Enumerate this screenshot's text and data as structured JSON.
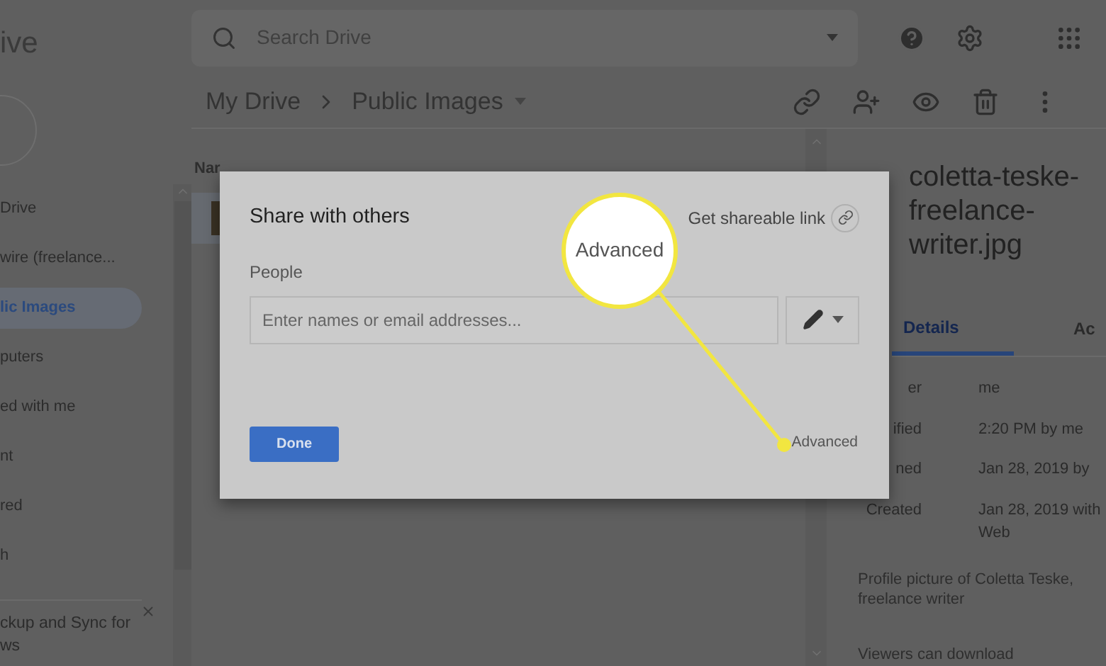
{
  "app_title": "ive",
  "sidebar": {
    "items": [
      {
        "label": "Drive",
        "selected": false
      },
      {
        "label": "wire (freelance...",
        "selected": false
      },
      {
        "label": "lic Images",
        "selected": true
      },
      {
        "label": "puters",
        "selected": false
      },
      {
        "label": "ed with me",
        "selected": false
      },
      {
        "label": "nt",
        "selected": false
      },
      {
        "label": "red",
        "selected": false
      },
      {
        "label": "h",
        "selected": false
      }
    ],
    "promo": {
      "text": "ckup and Sync for\nws"
    }
  },
  "search": {
    "placeholder": "Search Drive"
  },
  "breadcrumb": [
    "My Drive",
    "Public Images"
  ],
  "list": {
    "column_1": "Nar"
  },
  "details": {
    "title": "coletta-teske-freelance-writer.jpg",
    "tabs": [
      {
        "label": "Details",
        "selected": true
      },
      {
        "label": "Ac",
        "selected": false
      }
    ],
    "rows": [
      {
        "label": "er",
        "value": [
          "me"
        ]
      },
      {
        "label": "ified",
        "value": [
          "2:20 PM by me"
        ]
      },
      {
        "label": "ned",
        "value": [
          "Jan 28, 2019 by"
        ]
      },
      {
        "label": "Created",
        "value": [
          "Jan 28, 2019 with",
          "Web"
        ]
      }
    ],
    "description": "Profile picture of Coletta Teske, freelance writer",
    "download": "Viewers can download"
  },
  "dialog": {
    "title": "Share with others",
    "shareable_link": "Get shareable link",
    "people_label": "People",
    "input": {
      "placeholder": "Enter names or email addresses..."
    },
    "done": "Done",
    "advanced": "Advanced"
  },
  "callout": {
    "text": "Advanced"
  }
}
